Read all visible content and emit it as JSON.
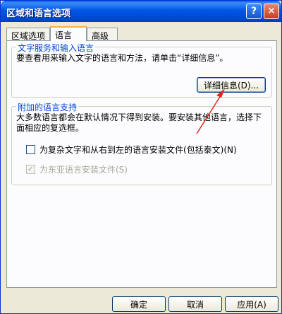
{
  "window": {
    "title": "区域和语言选项"
  },
  "titlebar": {
    "help_glyph": "?",
    "close_glyph": "✕"
  },
  "tabs": [
    {
      "label": "区域选项",
      "active": false
    },
    {
      "label": "语言",
      "active": true
    },
    {
      "label": "高级",
      "active": false
    }
  ],
  "text_services": {
    "legend": "文字服务和输入语言",
    "description": "要查看用来输入文字的语言和方法，请单击“详细信息”。",
    "details_button": "详细信息(D)..."
  },
  "supplemental": {
    "legend": "附加的语言支持",
    "description": "大多数语言都会在默认情况下得到安装。要安装其他语言，选择下面相应的复选框。",
    "complex_script": {
      "label": "为复杂文字和从右到左的语言安装文件(包括泰文)(N)",
      "checked": false,
      "enabled": true
    },
    "east_asian": {
      "label": "为东亚语言安装文件(S)",
      "checked": true,
      "enabled": false,
      "check_glyph": "✓"
    }
  },
  "footer": {
    "ok": "确定",
    "cancel": "取消",
    "apply": "应用(A)"
  },
  "colors": {
    "title_blue": "#0058e6",
    "legend_blue": "#0046d5",
    "annotation_red": "#e0261c"
  }
}
